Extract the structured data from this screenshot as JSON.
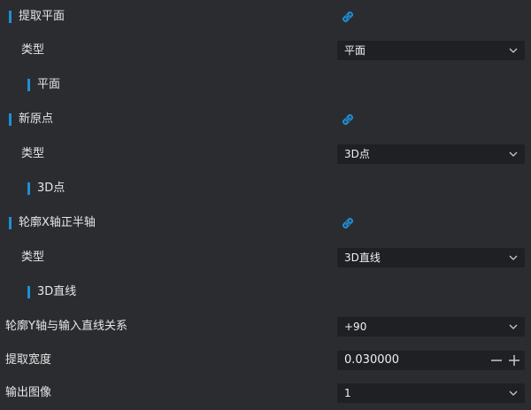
{
  "sections": [
    {
      "title": "提取平面",
      "type_label": "类型",
      "type_value": "平面",
      "sub_label": "平面"
    },
    {
      "title": "新原点",
      "type_label": "类型",
      "type_value": "3D点",
      "sub_label": "3D点"
    },
    {
      "title": "轮廓X轴正半轴",
      "type_label": "类型",
      "type_value": "3D直线",
      "sub_label": "3D直线"
    }
  ],
  "relation": {
    "label": "轮廓Y轴与输入直线关系",
    "value": "+90"
  },
  "width": {
    "label": "提取宽度",
    "value": "0.030000"
  },
  "output_image": {
    "label": "输出图像",
    "value": "1"
  },
  "colors": {
    "accent": "#1e8fd6",
    "background": "#2b2c30",
    "control": "#1f2024"
  }
}
